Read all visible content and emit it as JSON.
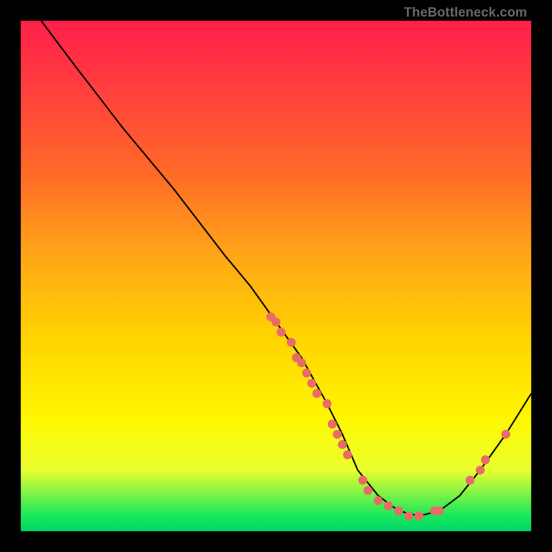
{
  "watermark": "TheBottleneck.com",
  "chart_data": {
    "type": "line",
    "title": "",
    "xlabel": "",
    "ylabel": "",
    "xlim": [
      0,
      100
    ],
    "ylim": [
      0,
      100
    ],
    "grid": false,
    "legend": false,
    "series": [
      {
        "name": "curve",
        "x": [
          4,
          10,
          20,
          30,
          40,
          45,
          50,
          55,
          60,
          63,
          66,
          70,
          74,
          78,
          82,
          86,
          90,
          95,
          100
        ],
        "y": [
          100,
          92,
          79,
          67,
          54,
          48,
          41,
          34,
          25,
          19,
          12,
          7,
          4,
          3,
          4,
          7,
          12,
          19,
          27
        ]
      }
    ],
    "markers": [
      {
        "name": "marker",
        "x": 49,
        "y": 42
      },
      {
        "name": "marker",
        "x": 50,
        "y": 41
      },
      {
        "name": "marker",
        "x": 51,
        "y": 39
      },
      {
        "name": "marker",
        "x": 53,
        "y": 37
      },
      {
        "name": "marker",
        "x": 54,
        "y": 34
      },
      {
        "name": "marker",
        "x": 55,
        "y": 33
      },
      {
        "name": "marker",
        "x": 56,
        "y": 31
      },
      {
        "name": "marker",
        "x": 57,
        "y": 29
      },
      {
        "name": "marker",
        "x": 58,
        "y": 27
      },
      {
        "name": "marker",
        "x": 60,
        "y": 25
      },
      {
        "name": "marker",
        "x": 61,
        "y": 21
      },
      {
        "name": "marker",
        "x": 62,
        "y": 19
      },
      {
        "name": "marker",
        "x": 63,
        "y": 17
      },
      {
        "name": "marker",
        "x": 64,
        "y": 15
      },
      {
        "name": "marker",
        "x": 67,
        "y": 10
      },
      {
        "name": "marker",
        "x": 68,
        "y": 8
      },
      {
        "name": "marker",
        "x": 70,
        "y": 6
      },
      {
        "name": "marker",
        "x": 72,
        "y": 5
      },
      {
        "name": "marker",
        "x": 74,
        "y": 4
      },
      {
        "name": "marker",
        "x": 76,
        "y": 3
      },
      {
        "name": "marker",
        "x": 78,
        "y": 3
      },
      {
        "name": "marker",
        "x": 81,
        "y": 4
      },
      {
        "name": "marker",
        "x": 82,
        "y": 4
      },
      {
        "name": "marker",
        "x": 88,
        "y": 10
      },
      {
        "name": "marker",
        "x": 90,
        "y": 12
      },
      {
        "name": "marker",
        "x": 91,
        "y": 14
      },
      {
        "name": "marker",
        "x": 95,
        "y": 19
      }
    ],
    "marker_color": "#e86b67",
    "curve_color": "#000000"
  }
}
